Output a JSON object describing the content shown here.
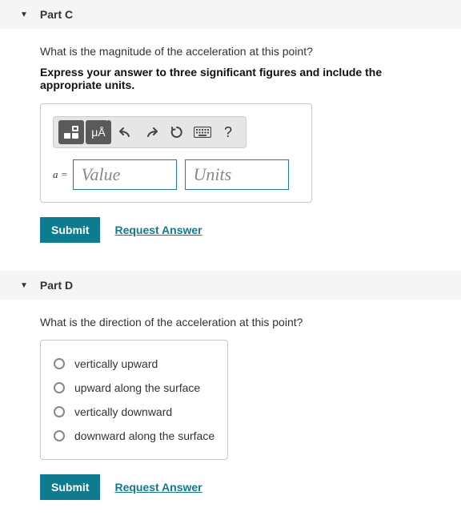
{
  "partC": {
    "title": "Part C",
    "prompt": "What is the magnitude of the acceleration at this point?",
    "instructions": "Express your answer to three significant figures and include the appropriate units.",
    "toolbar": {
      "templates_icon": "templates-icon",
      "mua_char": "μÅ",
      "undo": "undo",
      "redo": "redo",
      "reset": "reset",
      "keyboard": "keyboard",
      "help": "?"
    },
    "var_label": "a =",
    "value_placeholder": "Value",
    "units_placeholder": "Units",
    "submit_label": "Submit",
    "request_label": "Request Answer"
  },
  "partD": {
    "title": "Part D",
    "prompt": "What is the direction of the acceleration at this point?",
    "choices": [
      {
        "label": "vertically upward"
      },
      {
        "label": "upward along the surface"
      },
      {
        "label": "vertically downward"
      },
      {
        "label": "downward along the surface"
      }
    ],
    "submit_label": "Submit",
    "request_label": "Request Answer"
  }
}
